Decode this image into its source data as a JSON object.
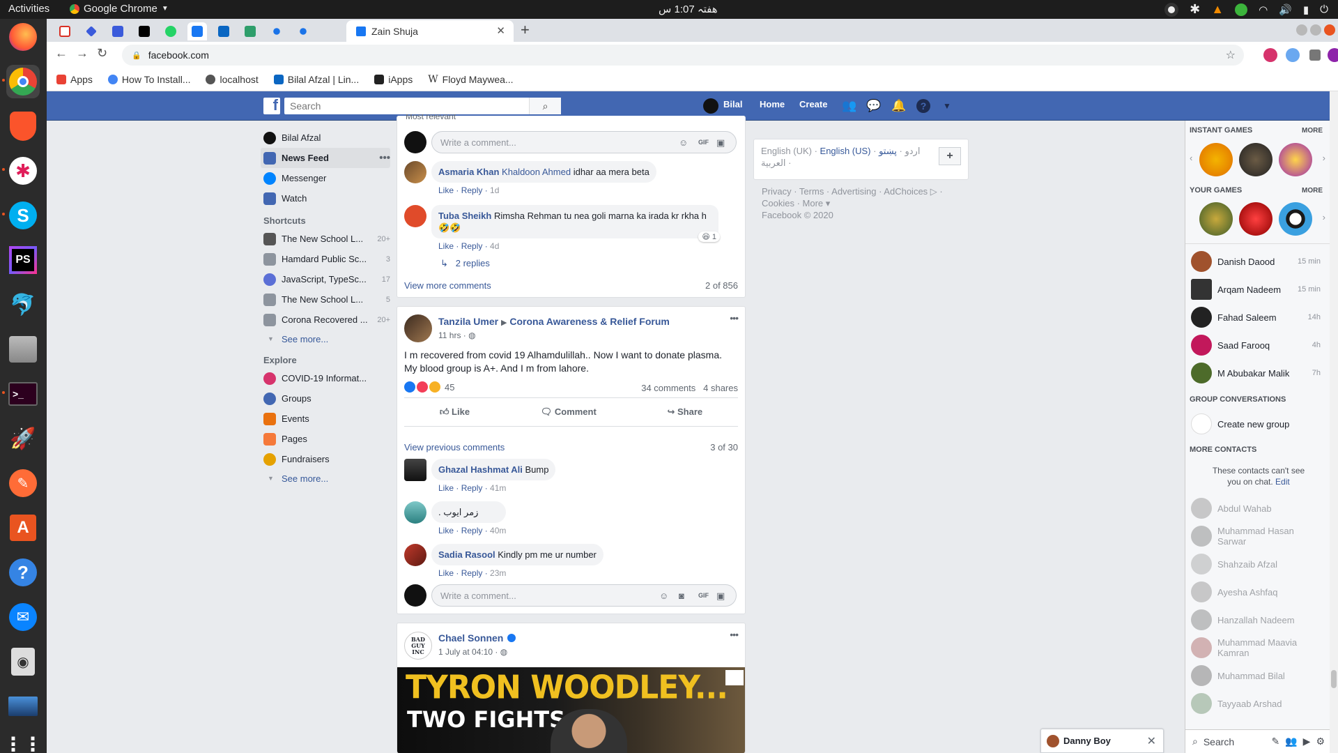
{
  "os": {
    "activities": "Activities",
    "app_name": "Google Chrome",
    "clock": "ھفتہ 1:07 س"
  },
  "browser": {
    "active_tab_title": "Zain Shuja",
    "url": "facebook.com",
    "bookmarks": [
      {
        "label": "Apps",
        "color": "#e94235"
      },
      {
        "label": "How To Install...",
        "color": "#4285f4"
      },
      {
        "label": "localhost",
        "color": "#555555"
      },
      {
        "label": "Bilal Afzal | Lin...",
        "color": "#0a66c2"
      },
      {
        "label": "iApps",
        "color": "#222222"
      },
      {
        "label": "Floyd Maywea...",
        "color": "#333333"
      }
    ]
  },
  "fb": {
    "search_placeholder": "Search",
    "user_name": "Bilal",
    "nav_home": "Home",
    "nav_create": "Create"
  },
  "left_nav": {
    "profile": "Bilal Afzal",
    "items": [
      {
        "label": "News Feed",
        "color": "#4267b2"
      },
      {
        "label": "Messenger",
        "color": "#0084ff"
      },
      {
        "label": "Watch",
        "color": "#4267b2"
      }
    ],
    "shortcuts_heading": "Shortcuts",
    "shortcuts": [
      {
        "label": "The New School L...",
        "count": "20+"
      },
      {
        "label": "Hamdard Public Sc...",
        "count": "3"
      },
      {
        "label": "JavaScript, TypeSc...",
        "count": "17"
      },
      {
        "label": "The New School L...",
        "count": "5"
      },
      {
        "label": "Corona Recovered ...",
        "count": "20+"
      }
    ],
    "see_more": "See more...",
    "explore_heading": "Explore",
    "explore": [
      {
        "label": "COVID-19 Informat...",
        "color": "#d6336c"
      },
      {
        "label": "Groups",
        "color": "#4267b2"
      },
      {
        "label": "Events",
        "color": "#e9710f"
      },
      {
        "label": "Pages",
        "color": "#f5793a"
      },
      {
        "label": "Fundraisers",
        "color": "#e5a100"
      }
    ]
  },
  "post1": {
    "partial_label": "Most relevant",
    "write_comment": "Write a comment...",
    "comments": [
      {
        "name": "Asmaria Khan",
        "tag": "Khaldoon Ahmed",
        "text": "idhar aa mera beta",
        "like": "Like",
        "reply": "Reply",
        "time": "1d"
      },
      {
        "name": "Tuba Sheikh",
        "text": "Rimsha Rehman tu nea goli marna ka irada kr rkha h 🤣🤣",
        "like": "Like",
        "reply": "Reply",
        "time": "4d",
        "reaction_count": "1"
      }
    ],
    "replies": "2 replies",
    "view_more": "View more comments",
    "count": "2 of 856"
  },
  "post2": {
    "author": "Tanzila Umer",
    "group": "Corona Awareness & Relief Forum",
    "time": "11 hrs",
    "text_line1": "I m recovered from covid 19 Alhamdulillah.. Now I want to donate plasma.",
    "text_line2": "My blood group is A+. And I m from lahore.",
    "reactions": "45",
    "comments_count": "34 comments",
    "shares": "4 shares",
    "action_like": "Like",
    "action_comment": "Comment",
    "action_share": "Share",
    "view_previous": "View previous comments",
    "count": "3 of 30",
    "comments": [
      {
        "name": "Ghazal Hashmat Ali",
        "text": "Bump",
        "like": "Like",
        "reply": "Reply",
        "time": "41m"
      },
      {
        "name": "",
        "text": ". زمر ایوب",
        "like": "Like",
        "reply": "Reply",
        "time": "40m"
      },
      {
        "name": "Sadia Rasool",
        "text": "Kindly pm me ur number",
        "like": "Like",
        "reply": "Reply",
        "time": "23m"
      }
    ],
    "write_comment": "Write a comment..."
  },
  "post3": {
    "author": "Chael Sonnen",
    "time": "1 July at 04:10",
    "logo_text": "BAD GUY INC",
    "image_line1": "TYRON WOODLEY...",
    "image_line2": "TWO FIGHTS"
  },
  "right": {
    "languages": "English (UK) · English (US) · اردو · پښتو · العربية",
    "lang_uk": "English (UK)",
    "lang_us": "English (US)",
    "lang_ur": "اردو",
    "lang_ps": "پښتو",
    "lang_ar": "العربية",
    "footer1": "Privacy · Terms · Advertising · AdChoices ▷ ·",
    "footer2": "Cookies · More ▾",
    "copyright": "Facebook © 2020"
  },
  "chat": {
    "instant_games": "INSTANT GAMES",
    "your_games": "YOUR GAMES",
    "more": "MORE",
    "contacts": [
      {
        "name": "Danish Daood",
        "time": "15 min"
      },
      {
        "name": "Arqam Nadeem",
        "time": "15 min"
      },
      {
        "name": "Fahad Saleem",
        "time": "14h"
      },
      {
        "name": "Saad Farooq",
        "time": "4h"
      },
      {
        "name": "M Abubakar Malik",
        "time": "7h"
      }
    ],
    "group_conv": "GROUP CONVERSATIONS",
    "create_group": "Create new group",
    "more_contacts": "MORE CONTACTS",
    "hidden_note1": "These contacts can't see",
    "hidden_note2": "you on chat.",
    "edit": "Edit",
    "hidden_contacts": [
      "Abdul Wahab",
      "Muhammad Hasan Sarwar",
      "Shahzaib Afzal",
      "Ayesha Ashfaq",
      "Hanzallah Nadeem",
      "Muhammad Maavia Kamran",
      "Muhammad Bilal",
      "Tayyaab Arshad"
    ],
    "search": "Search",
    "open_chat": "Danny Boy"
  }
}
